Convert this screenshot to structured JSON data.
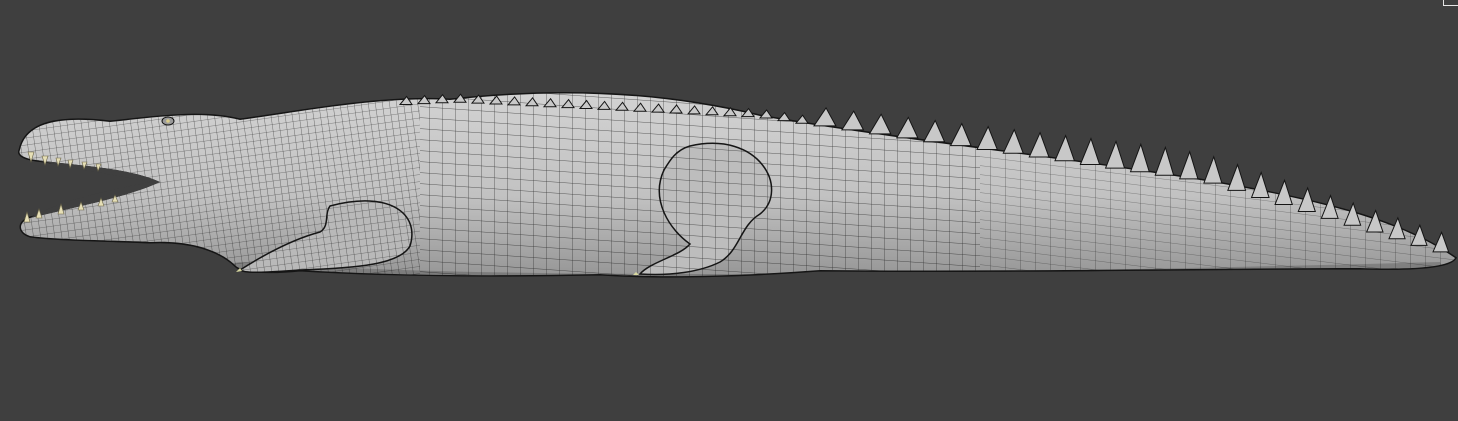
{
  "viewport": {
    "background": "#3f3f3f"
  },
  "model": {
    "subject": "crocodile-wireframe-mesh",
    "surface_color": "#bdbdbd",
    "wire_color": "#1c1c1c",
    "teeth_color": "#e6dfb6",
    "claw_color": "#d8d8a0"
  }
}
